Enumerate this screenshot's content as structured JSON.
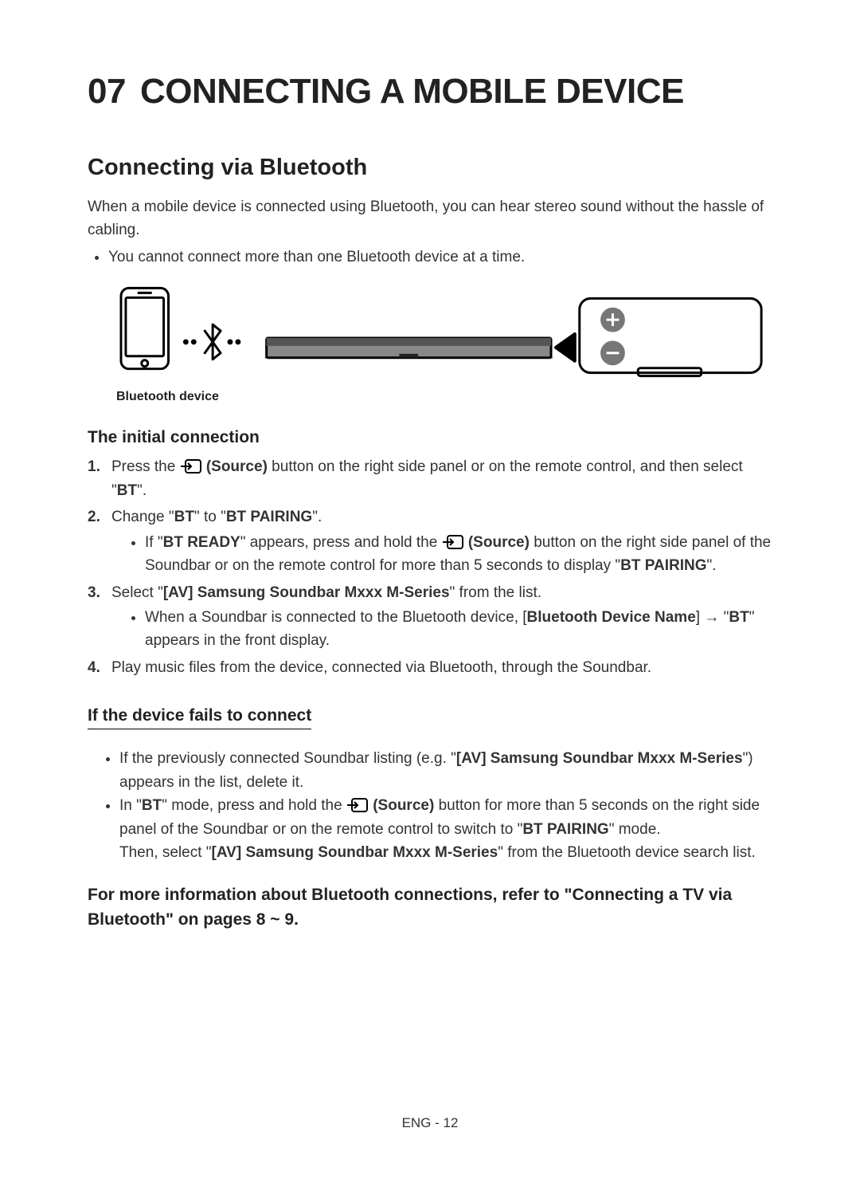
{
  "chapter": {
    "number": "07",
    "title": "CONNECTING A MOBILE DEVICE"
  },
  "section1": {
    "title": "Connecting via Bluetooth",
    "intro": "When a mobile device is connected using Bluetooth, you can hear stereo sound without the hassle of cabling.",
    "bullets": [
      "You cannot connect more than one Bluetooth device at a time."
    ],
    "figure_caption": "Bluetooth device"
  },
  "initial": {
    "title": "The initial connection",
    "steps": [
      {
        "num": "1.",
        "pre": "Press the ",
        "source_label": " (Source)",
        "post": " button on the right side panel or on the remote control, and then select \"",
        "bt": "BT",
        "close": "\"."
      },
      {
        "num": "2.",
        "t1": "Change \"",
        "t2": "BT",
        "t3": "\" to \"",
        "t4": "BT PAIRING",
        "t5": "\".",
        "sub_pre": "If \"",
        "sub_ready": "BT READY",
        "sub_mid": "\" appears, press and hold the ",
        "sub_src": " (Source)",
        "sub_post1": " button on the right side panel of the Soundbar or on the remote control for more than 5 seconds to display \"",
        "sub_pairing": "BT PAIRING",
        "sub_close": "\"."
      },
      {
        "num": "3.",
        "t1": "Select \"",
        "t2": "[AV] Samsung Soundbar Mxxx M-Series",
        "t3": "\" from the list.",
        "sub_a": "When a Soundbar is connected to the Bluetooth device, [",
        "sub_b": "Bluetooth Device Name",
        "sub_c": "] → \"",
        "sub_d": "BT",
        "sub_e": "\" appears in the front display."
      },
      {
        "num": "4.",
        "text": "Play music files from the device, connected via Bluetooth, through the Soundbar."
      }
    ]
  },
  "fails": {
    "title": "If the device fails to connect",
    "b1a": "If the previously connected Soundbar listing (e.g. \"",
    "b1b": "[AV] Samsung Soundbar Mxxx M-Series",
    "b1c": "\") appears in the list, delete it.",
    "b2a": "In \"",
    "b2b": "BT",
    "b2c": "\" mode, press and hold the ",
    "b2src": " (Source)",
    "b2d": " button for more than 5 seconds on the right side panel of the Soundbar or on the remote control to switch to \"",
    "b2e": "BT PAIRING",
    "b2f": "\" mode.",
    "b2g": "Then, select \"",
    "b2h": "[AV] Samsung Soundbar Mxxx M-Series",
    "b2i": "\" from the Bluetooth device search list."
  },
  "more_info": "For more information about Bluetooth connections, refer to \"Connecting a TV via Bluetooth\" on pages 8 ~ 9.",
  "footer": "ENG - 12"
}
